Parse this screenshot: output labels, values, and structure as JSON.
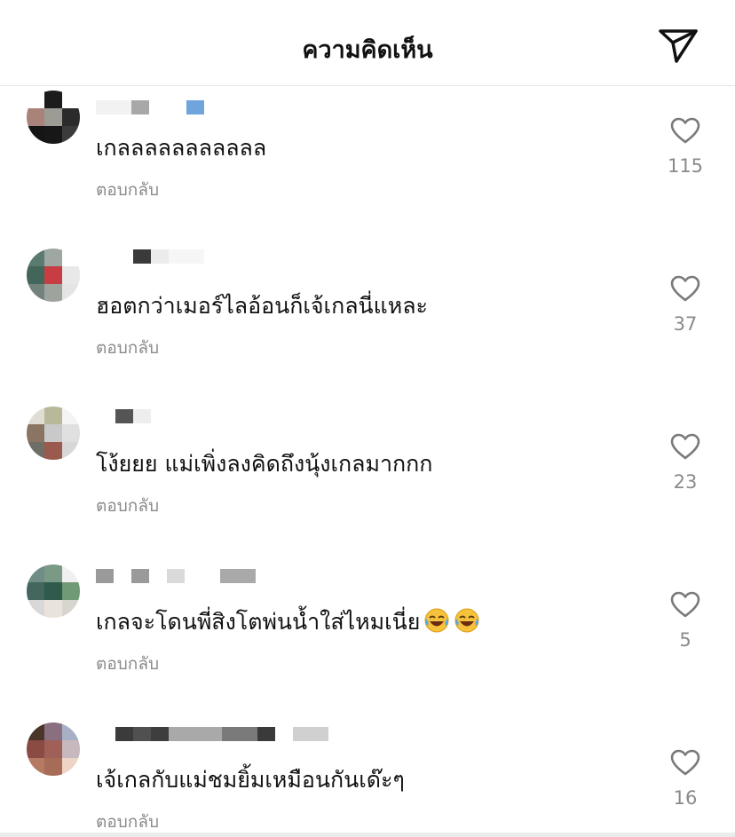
{
  "header": {
    "title": "ความคิดเห็น"
  },
  "colors": {
    "text": "#111111",
    "muted": "#8a8a8a",
    "divider": "#e6e6e6"
  },
  "comments": [
    {
      "text": "เกลลลลลลลลลลล",
      "reply_label": "ตอบกลับ",
      "likes": "115",
      "emoji": ""
    },
    {
      "text": "ฮอตกว่าเมอร์ไลอ้อนก็เจ้เกลนี่แหละ",
      "reply_label": "ตอบกลับ",
      "likes": "37",
      "emoji": ""
    },
    {
      "text": "โง้ยยย แม่เพิ่งลงคิดถึงนุ้งเกลมากกก",
      "reply_label": "ตอบกลับ",
      "likes": "23",
      "emoji": ""
    },
    {
      "text": "เกลจะโดนพี่สิงโตพ่นน้ำใส่ไหมเนี่ย",
      "reply_label": "ตอบกลับ",
      "likes": "5",
      "emoji": "face-with-tears-of-joy"
    },
    {
      "text": "เจ้เกลกับแม่ชมยิ้มเหมือนกันเด๊ะๆ",
      "reply_label": "ตอบกลับ",
      "likes": "16",
      "emoji": ""
    }
  ],
  "icons": {
    "send": "send-icon",
    "like": "heart-outline-icon",
    "emoji": "face-with-tears-of-joy-icon"
  }
}
